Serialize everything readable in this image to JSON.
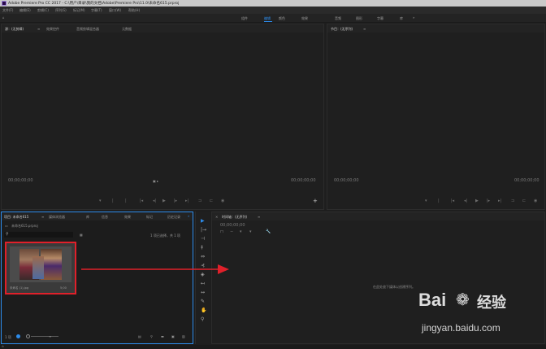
{
  "titlebar": {
    "title": "Adobe Premiere Pro CC 2017 - C:\\用户\\目录\\我的文档\\Adobe\\Premiere Pro\\11.0\\未命名615.prproj"
  },
  "menubar": {
    "items": [
      "文件(F)",
      "编辑(E)",
      "剪辑(C)",
      "序列(S)",
      "标记(M)",
      "字幕(T)",
      "窗口(W)",
      "帮助(H)"
    ]
  },
  "workspaces": {
    "items": [
      "组件",
      "编辑",
      "颜色",
      "效果",
      "音频",
      "图形",
      "字幕",
      "库"
    ],
    "active_index": 1,
    "overflow": "»"
  },
  "source_panel": {
    "tabs": [
      "源：(无剪辑)",
      "效果控件",
      "音频剪辑混合器",
      "元数据"
    ],
    "tc_left": "00;00;00;00",
    "tc_right": "00;00;00;00"
  },
  "program_panel": {
    "tab": "节目：(无序列)",
    "tc_left": "00;00;00;00",
    "tc_right": "00;00;00;00"
  },
  "project_panel": {
    "tabs": [
      "项目: 未命名615",
      "媒体浏览器",
      "库",
      "信息",
      "效果",
      "标记",
      "历史记录"
    ],
    "project_file": "未命名615.prproj",
    "selection_status": "1 项已选择，共 1 项",
    "clip_name": "未命名 (1).jpg",
    "clip_duration": "5;00",
    "zoom_label": "1",
    "bottom_left_label": "1 项"
  },
  "timeline_panel": {
    "tab": "时间轴：(无序列)",
    "timecode": "00;00;00;00",
    "empty_message": "在此处放下媒体以创建序列。"
  },
  "watermark": {
    "brand": "Bai",
    "brand2": "经验",
    "url": "jingyan.baidu.com"
  },
  "colors": {
    "accent": "#2d8ceb",
    "highlight_border": "#e0202a",
    "arrow": "#e0202a"
  }
}
